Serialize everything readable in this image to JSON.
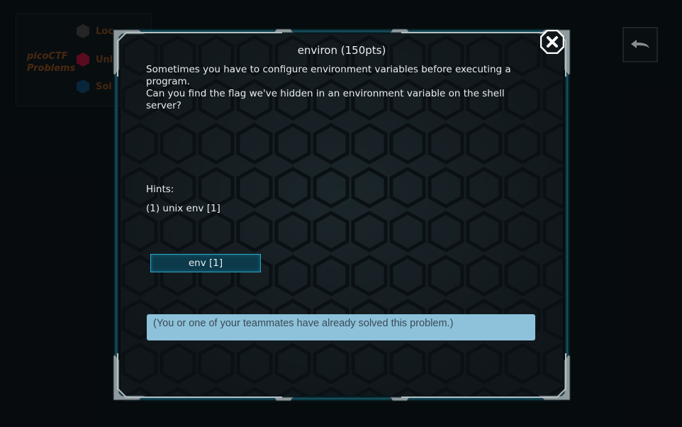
{
  "background": {
    "title_line1": "picoCTF",
    "title_line2": "Problems",
    "legend": [
      {
        "label": "Loc",
        "color": "#3a3a3a"
      },
      {
        "label": "Unl",
        "color": "#8a1230"
      },
      {
        "label": "Sol",
        "color": "#0e3a5a"
      }
    ]
  },
  "modal": {
    "title": "environ (150pts)",
    "description_line1": "Sometimes you have to configure environment variables before executing a program.",
    "description_line2": "Can you find the flag we've hidden in an environment variable on the shell server?",
    "hints_label": "Hints:",
    "hints": [
      "(1) unix env [1]"
    ],
    "hint_button_label": "env [1]",
    "solved_message": "(You or one of your teammates have already solved this problem.)"
  },
  "colors": {
    "accent": "#2aa8c8",
    "banner": "#8ec2db",
    "brand_orange": "#b45a1c"
  }
}
